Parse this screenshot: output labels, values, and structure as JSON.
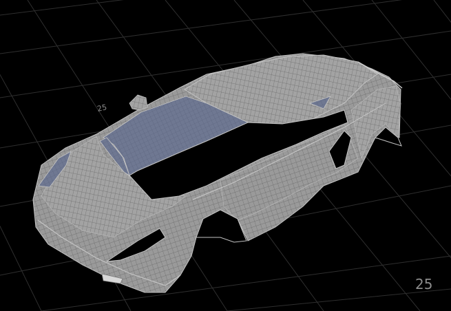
{
  "viewport": {
    "background": "#000000",
    "grid_color": "#2f2f2f",
    "grid_labels": [
      "25",
      "25"
    ]
  },
  "model": {
    "type": "car",
    "display_mode": "wireframe-on-shaded",
    "surface_color": "#9a9a9a",
    "wire_color": "#5c5c5c",
    "glass_color": "#6f7892",
    "rim_color": "#c4c4c4"
  }
}
